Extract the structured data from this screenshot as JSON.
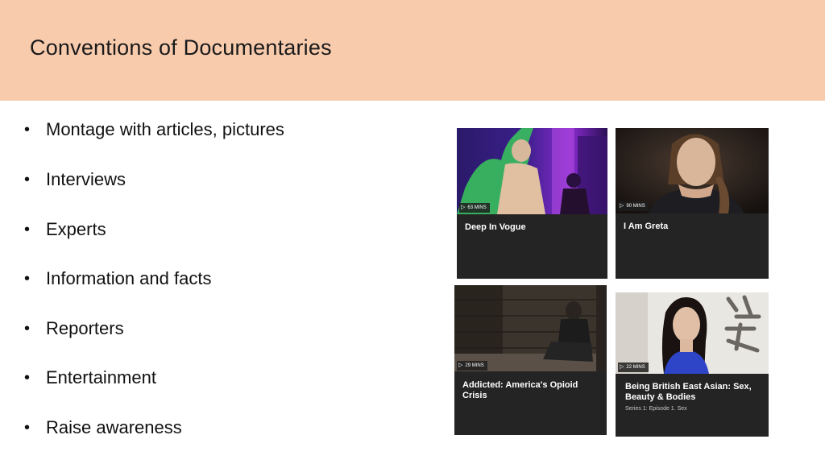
{
  "slide": {
    "title": "Conventions of Documentaries",
    "bullets": [
      "Montage with articles, pictures",
      "Interviews",
      "Experts",
      "Information and facts",
      "Reporters",
      "Entertainment",
      "Raise awareness"
    ]
  },
  "cards": [
    {
      "duration": "63 MINS",
      "title": "Deep In Vogue",
      "subtitle": ""
    },
    {
      "duration": "90 MINS",
      "title": "I Am Greta",
      "subtitle": ""
    },
    {
      "duration": "29 MINS",
      "title": "Addicted: America's Opioid Crisis",
      "subtitle": ""
    },
    {
      "duration": "22 MINS",
      "title": "Being British East Asian: Sex, Beauty & Bodies",
      "subtitle": "Series 1: Episode 1. Sex"
    }
  ],
  "colors": {
    "header_bg": "#f8cbad",
    "card_bg": "#252424"
  }
}
